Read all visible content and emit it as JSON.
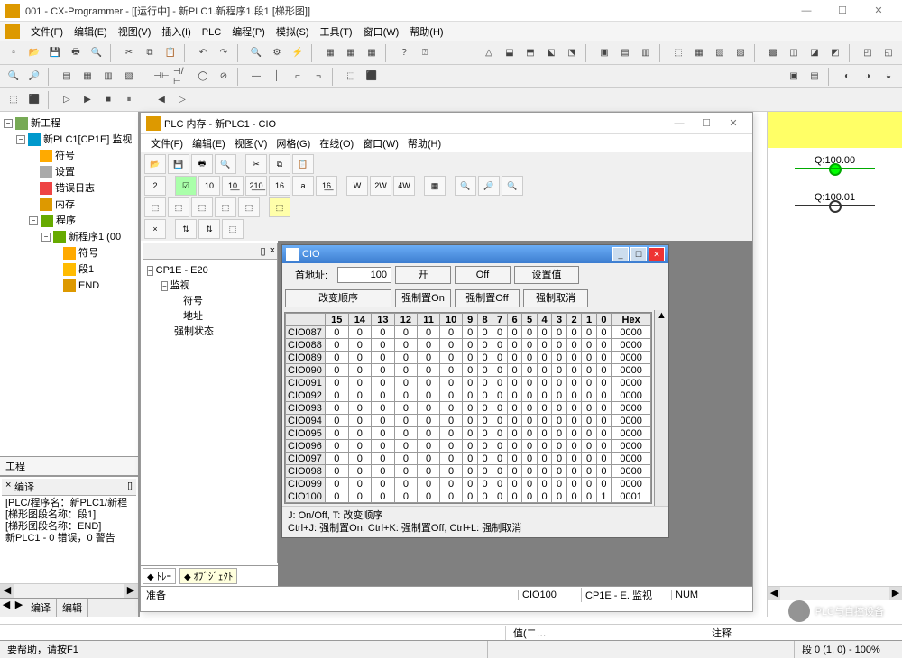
{
  "window": {
    "title": "001 - CX-Programmer - [[运行中] - 新PLC1.新程序1.段1 [梯形图]]"
  },
  "main_menu": [
    "文件(F)",
    "编辑(E)",
    "视图(V)",
    "插入(I)",
    "PLC",
    "编程(P)",
    "模拟(S)",
    "工具(T)",
    "窗口(W)",
    "帮助(H)"
  ],
  "tree": {
    "root": "新工程",
    "plc": "新PLC1[CP1E] 监视",
    "items": [
      "符号",
      "设置",
      "错误日志",
      "内存",
      "程序"
    ],
    "prog": "新程序1 (00",
    "sections": [
      "符号",
      "段1",
      "END"
    ]
  },
  "proj_tab": "工程",
  "compile": {
    "hdr": "编译",
    "lines": [
      "[PLC/程序名：新PLC1/新程",
      "[梯形图段名称：段1]",
      "[梯形图段名称：END]",
      "",
      "新PLC1 - 0 错误，0 警告"
    ]
  },
  "compile_tabs": [
    "编译",
    "编辑"
  ],
  "ladder": {
    "q1": "Q:100.00",
    "q2": "Q:100.01"
  },
  "child": {
    "title": "PLC 内存 - 新PLC1 - CIO",
    "menu": [
      "文件(F)",
      "编辑(E)",
      "视图(V)",
      "网格(G)",
      "在线(O)",
      "窗口(W)",
      "帮助(H)"
    ],
    "tree_title": "CP1E - E20",
    "tree_items": [
      "监视",
      "符号",
      "地址",
      "强制状态"
    ],
    "tabs": [
      "ﾄﾚｰ",
      "ｵﾌﾞｼﾞｪｸﾄ"
    ],
    "status": "准备"
  },
  "cio": {
    "title": "CIO",
    "labels": {
      "start": "首地址:",
      "start_val": "100",
      "on": "开",
      "off": "Off",
      "setval": "设置值",
      "chgord": "改变顺序",
      "forceon": "强制置On",
      "forceoff": "强制置Off",
      "forcecancel": "强制取消"
    },
    "bitcols": [
      "15",
      "14",
      "13",
      "12",
      "11",
      "10",
      "9",
      "8",
      "7",
      "6",
      "5",
      "4",
      "3",
      "2",
      "1",
      "0",
      "Hex"
    ],
    "rows": [
      {
        "addr": "CIO087",
        "bits": [
          0,
          0,
          0,
          0,
          0,
          0,
          0,
          0,
          0,
          0,
          0,
          0,
          0,
          0,
          0,
          0
        ],
        "hex": "0000"
      },
      {
        "addr": "CIO088",
        "bits": [
          0,
          0,
          0,
          0,
          0,
          0,
          0,
          0,
          0,
          0,
          0,
          0,
          0,
          0,
          0,
          0
        ],
        "hex": "0000"
      },
      {
        "addr": "CIO089",
        "bits": [
          0,
          0,
          0,
          0,
          0,
          0,
          0,
          0,
          0,
          0,
          0,
          0,
          0,
          0,
          0,
          0
        ],
        "hex": "0000"
      },
      {
        "addr": "CIO090",
        "bits": [
          0,
          0,
          0,
          0,
          0,
          0,
          0,
          0,
          0,
          0,
          0,
          0,
          0,
          0,
          0,
          0
        ],
        "hex": "0000"
      },
      {
        "addr": "CIO091",
        "bits": [
          0,
          0,
          0,
          0,
          0,
          0,
          0,
          0,
          0,
          0,
          0,
          0,
          0,
          0,
          0,
          0
        ],
        "hex": "0000"
      },
      {
        "addr": "CIO092",
        "bits": [
          0,
          0,
          0,
          0,
          0,
          0,
          0,
          0,
          0,
          0,
          0,
          0,
          0,
          0,
          0,
          0
        ],
        "hex": "0000"
      },
      {
        "addr": "CIO093",
        "bits": [
          0,
          0,
          0,
          0,
          0,
          0,
          0,
          0,
          0,
          0,
          0,
          0,
          0,
          0,
          0,
          0
        ],
        "hex": "0000"
      },
      {
        "addr": "CIO094",
        "bits": [
          0,
          0,
          0,
          0,
          0,
          0,
          0,
          0,
          0,
          0,
          0,
          0,
          0,
          0,
          0,
          0
        ],
        "hex": "0000"
      },
      {
        "addr": "CIO095",
        "bits": [
          0,
          0,
          0,
          0,
          0,
          0,
          0,
          0,
          0,
          0,
          0,
          0,
          0,
          0,
          0,
          0
        ],
        "hex": "0000"
      },
      {
        "addr": "CIO096",
        "bits": [
          0,
          0,
          0,
          0,
          0,
          0,
          0,
          0,
          0,
          0,
          0,
          0,
          0,
          0,
          0,
          0
        ],
        "hex": "0000"
      },
      {
        "addr": "CIO097",
        "bits": [
          0,
          0,
          0,
          0,
          0,
          0,
          0,
          0,
          0,
          0,
          0,
          0,
          0,
          0,
          0,
          0
        ],
        "hex": "0000"
      },
      {
        "addr": "CIO098",
        "bits": [
          0,
          0,
          0,
          0,
          0,
          0,
          0,
          0,
          0,
          0,
          0,
          0,
          0,
          0,
          0,
          0
        ],
        "hex": "0000"
      },
      {
        "addr": "CIO099",
        "bits": [
          0,
          0,
          0,
          0,
          0,
          0,
          0,
          0,
          0,
          0,
          0,
          0,
          0,
          0,
          0,
          0
        ],
        "hex": "0000"
      },
      {
        "addr": "CIO100",
        "bits": [
          0,
          0,
          0,
          0,
          0,
          0,
          0,
          0,
          0,
          0,
          0,
          0,
          0,
          0,
          0,
          1
        ],
        "hex": "0001"
      }
    ],
    "hint1": "J: On/Off,   T: 改变顺序",
    "hint2": "Ctrl+J: 强制置On,  Ctrl+K: 强制置Off,  Ctrl+L: 强制取消"
  },
  "bottom_headers": [
    "值(二…",
    "注释"
  ],
  "status": {
    "help": "要帮助，请按F1",
    "cio": "CIO100",
    "plc": "CP1E - E. 监视",
    "num": "NUM",
    "rung": "段 0 (1, 0) - 100%"
  },
  "watermark": "PLC与自控设备"
}
